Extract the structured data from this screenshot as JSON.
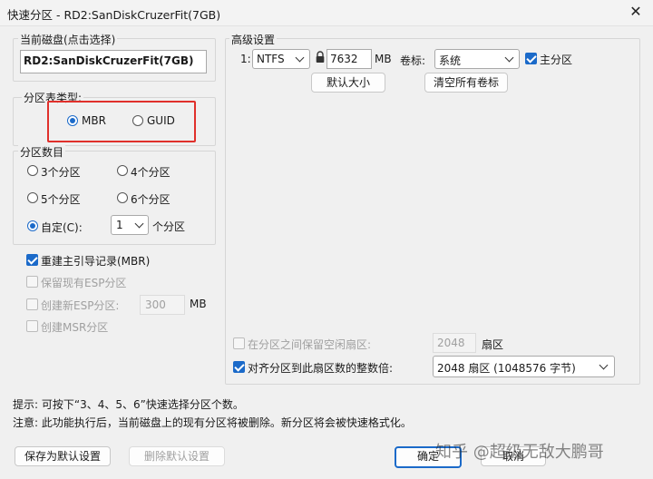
{
  "window": {
    "title": "快速分区 - RD2:SanDiskCruzerFit(7GB)",
    "close_glyph": "✕"
  },
  "disk_group": {
    "label": "当前磁盘(点击选择)",
    "disk_name": "RD2:SanDiskCruzerFit(7GB)"
  },
  "partition_table": {
    "label": "分区表类型:",
    "options": [
      "MBR",
      "GUID"
    ],
    "selected": "MBR"
  },
  "partition_count": {
    "label": "分区数目",
    "options": [
      "3个分区",
      "4个分区",
      "5个分区",
      "6个分区"
    ],
    "custom_label": "自定(C):",
    "custom_value": "1",
    "custom_suffix": "个分区",
    "selected": "自定(C):"
  },
  "options": {
    "rebuild_mbr": {
      "label": "重建主引导记录(MBR)",
      "checked": true
    },
    "keep_esp": {
      "label": "保留现有ESP分区",
      "checked": false
    },
    "create_esp": {
      "label": "创建新ESP分区:",
      "value": "300",
      "unit": "MB",
      "checked": false
    },
    "create_msr": {
      "label": "创建MSR分区",
      "checked": false
    }
  },
  "advanced": {
    "label": "高级设置",
    "index": "1:",
    "fs": "NTFS",
    "size": "7632",
    "size_unit": "MB",
    "volume_label_caption": "卷标:",
    "volume_label": "系统",
    "primary_label": "主分区",
    "primary_checked": true,
    "default_size_btn": "默认大小",
    "clear_labels_btn": "清空所有卷标",
    "keep_free_label": "在分区之间保留空闲扇区:",
    "keep_free_value": "2048",
    "keep_free_unit": "扇区",
    "keep_free_checked": false,
    "align_label": "对齐分区到此扇区数的整数倍:",
    "align_value": "2048 扇区 (1048576 字节)",
    "align_checked": true
  },
  "hints": {
    "tip": "提示: 可按下“3、4、5、6”快速选择分区个数。",
    "note": "注意: 此功能执行后，当前磁盘上的现有分区将被删除。新分区将会被快速格式化。"
  },
  "footer": {
    "save_default": "保存为默认设置",
    "delete_default": "删除默认设置",
    "ok": "确定",
    "cancel": "取消"
  },
  "watermark": "知乎 @超级无敌大鹏哥"
}
